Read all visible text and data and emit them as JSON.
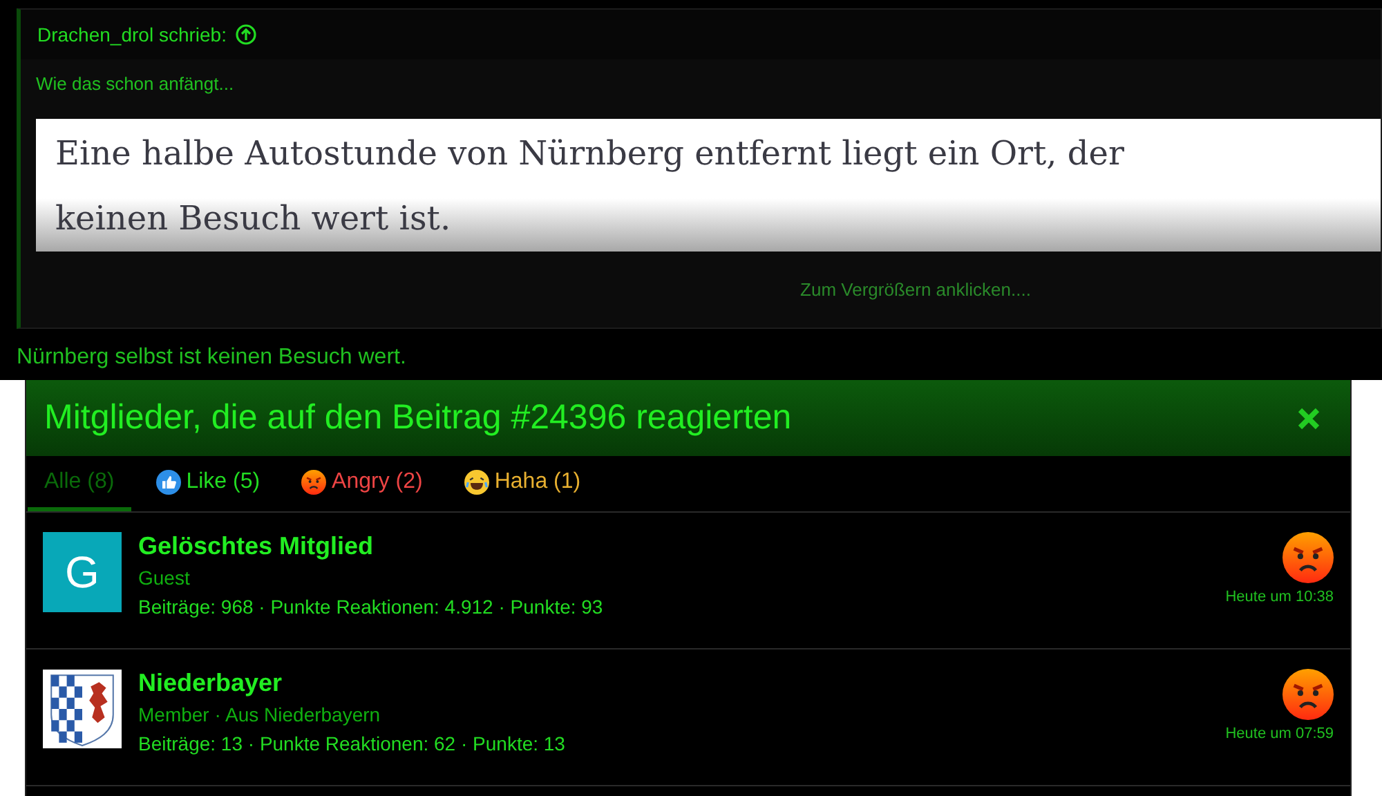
{
  "quote": {
    "author": "Drachen_drol schrieb:",
    "intro": "Wie das schon anfängt...",
    "image_lines": [
      "Eine halbe Autostunde von Nürnberg entfernt liegt ein Ort, der",
      "keinen Besuch wert ist."
    ],
    "expand": "Zum Vergrößern anklicken...."
  },
  "reply": "Nürnberg selbst ist keinen Besuch wert.",
  "dialog": {
    "title": "Mitglieder, die auf den Beitrag #24396 reagierten",
    "tabs": [
      {
        "kind": "all",
        "label": "Alle (8)",
        "color": "#0a6a0a",
        "selected": true
      },
      {
        "kind": "like",
        "label": "Like (5)",
        "color": "#22dd22",
        "selected": false
      },
      {
        "kind": "angry",
        "label": "Angry (2)",
        "color": "#ee4444",
        "selected": false
      },
      {
        "kind": "haha",
        "label": "Haha (1)",
        "color": "#e8b030",
        "selected": false
      }
    ],
    "members": [
      {
        "avatar": {
          "kind": "letter",
          "letter": "G"
        },
        "name": "Gelöschtes Mitglied",
        "title": "Guest",
        "stats": "Beiträge: 968 · Punkte Reaktionen: 4.912 · Punkte: 93",
        "reaction": {
          "kind": "angry"
        },
        "time": "Heute um 10:38"
      },
      {
        "avatar": {
          "kind": "crest"
        },
        "name": "Niederbayer",
        "title": "Member · Aus Niederbayern",
        "stats": "Beiträge: 13 · Punkte Reaktionen: 62 · Punkte: 13",
        "reaction": {
          "kind": "angry"
        },
        "time": "Heute um 07:59"
      }
    ]
  }
}
